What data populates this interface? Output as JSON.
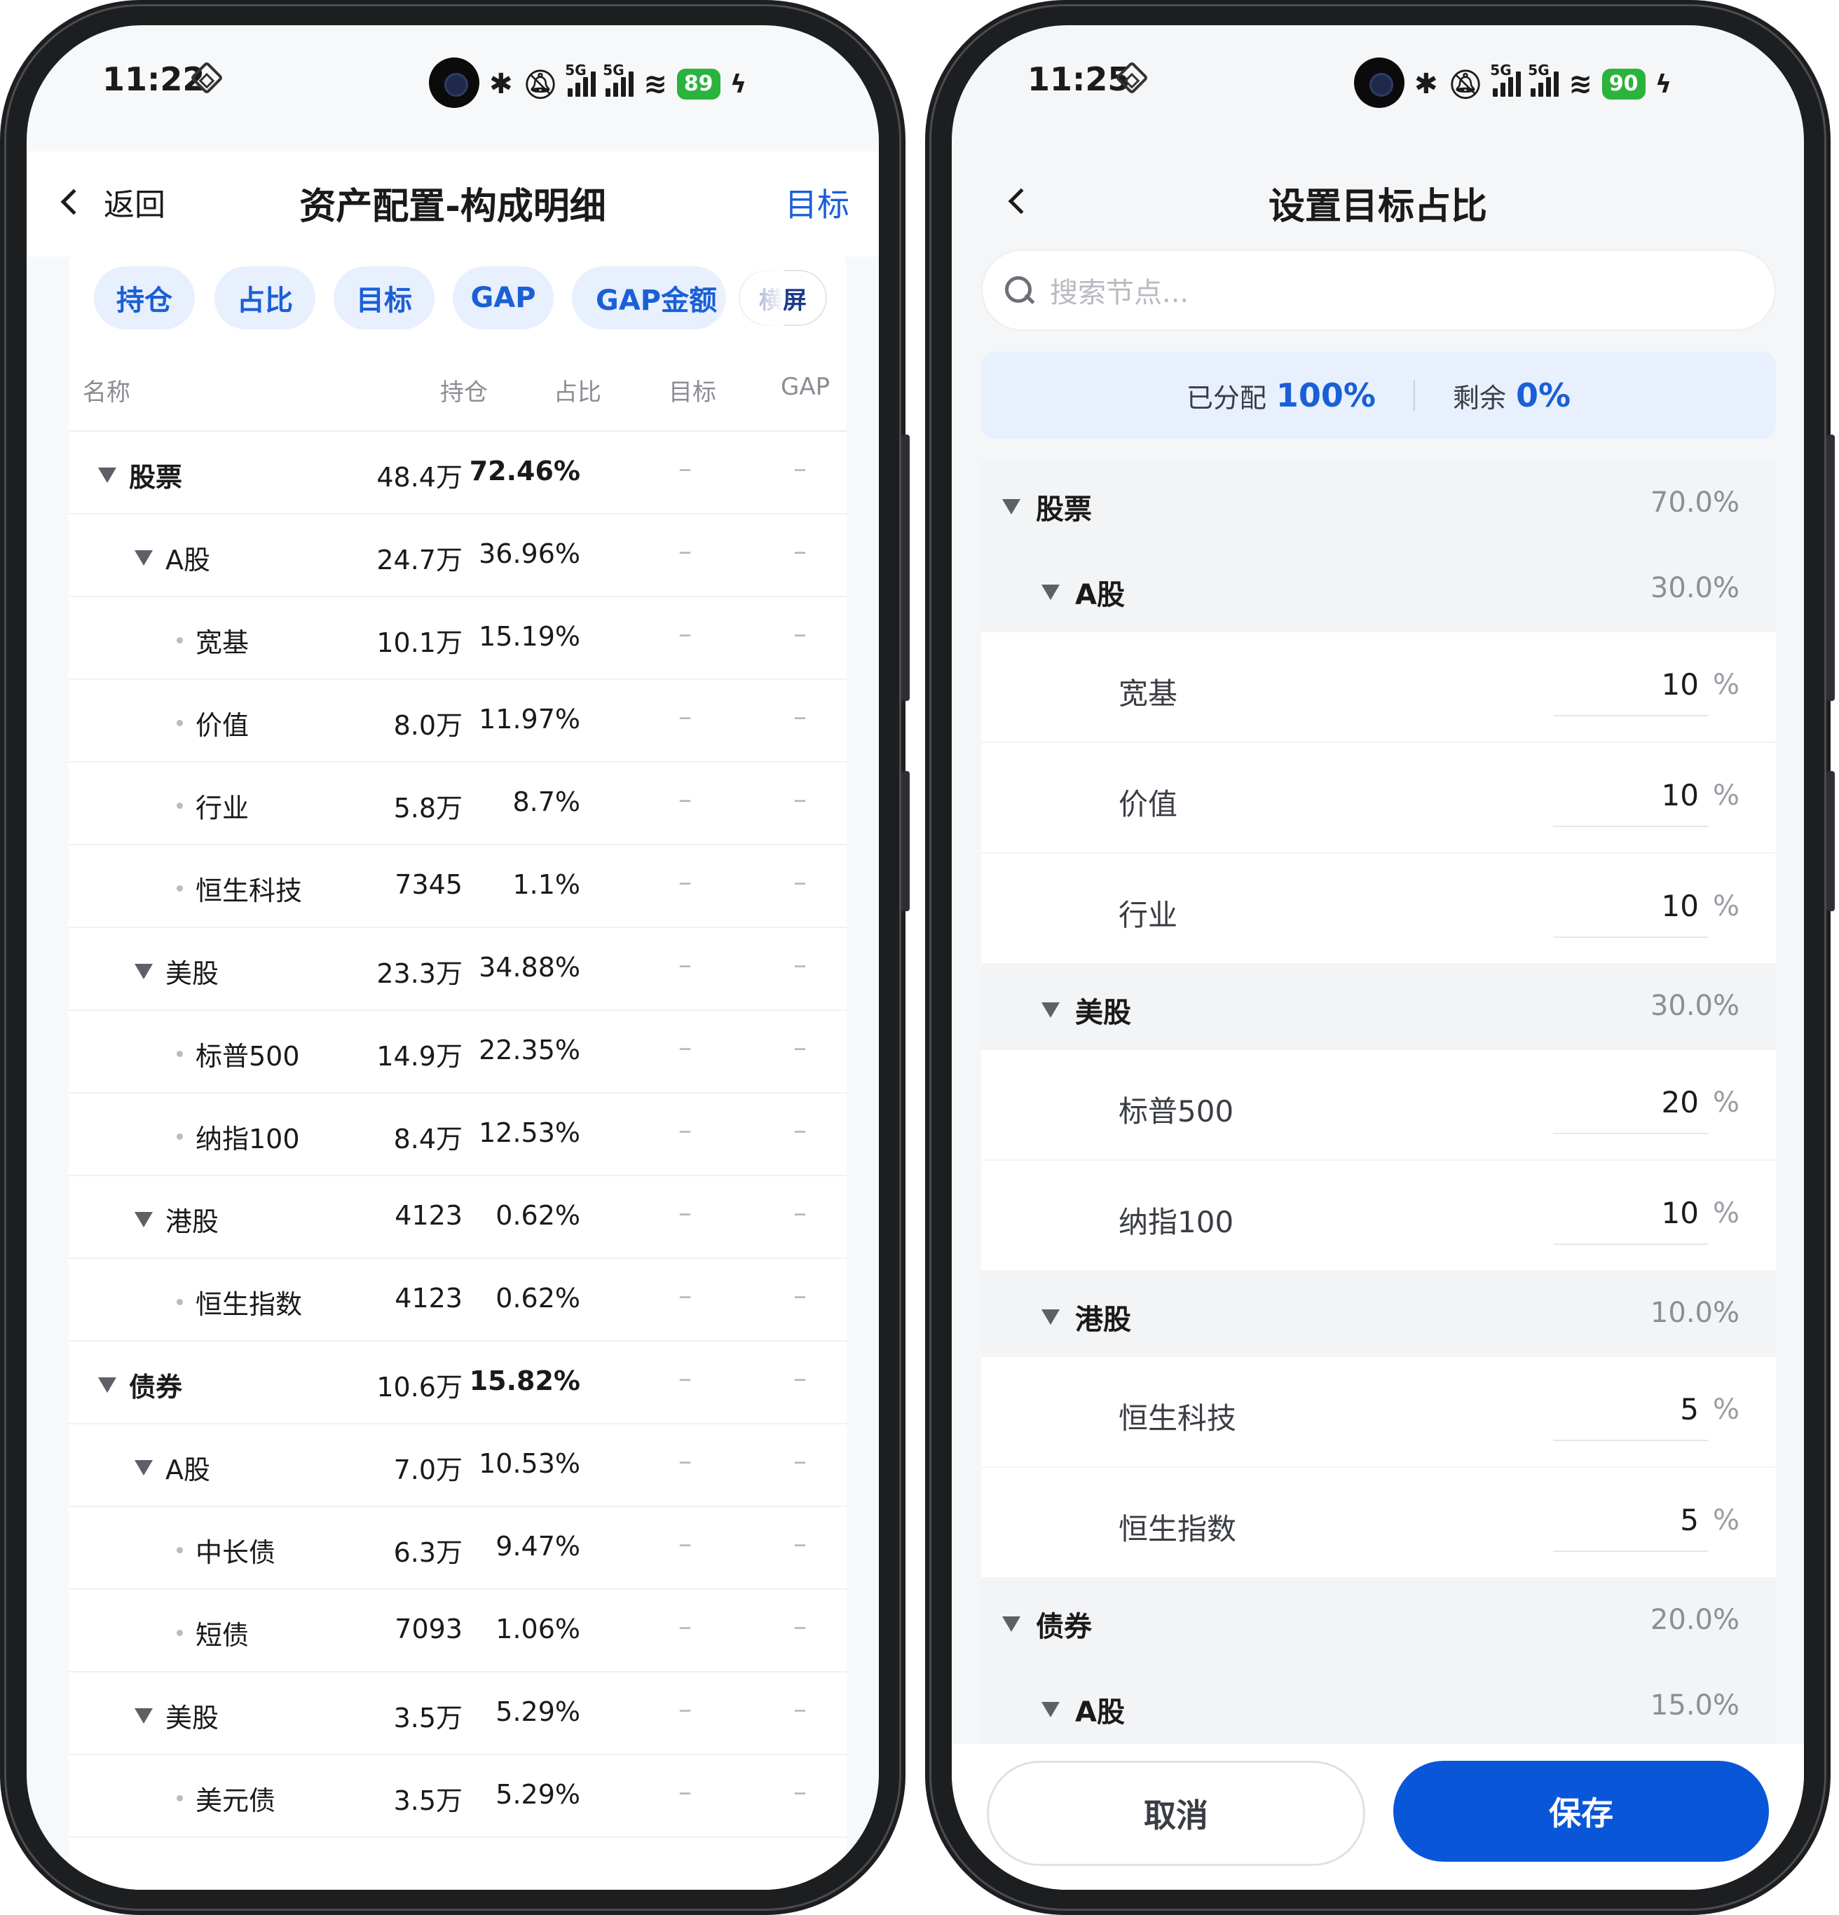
{
  "left": {
    "status": {
      "time": "11:22",
      "battery": "89"
    },
    "nav": {
      "back": "返回",
      "title": "资产配置-构成明细",
      "target": "目标"
    },
    "chips": [
      "持仓",
      "占比",
      "目标",
      "GAP",
      "GAP金额"
    ],
    "landscape": "横屏",
    "columns": {
      "name": "名称",
      "holding": "持仓",
      "ratio": "占比",
      "target": "目标",
      "gap": "GAP"
    },
    "dash": "–",
    "rows": [
      {
        "name": "股票",
        "holding": "48.4万",
        "ratio": "72.46%"
      },
      {
        "name": "A股",
        "holding": "24.7万",
        "ratio": "36.96%"
      },
      {
        "name": "宽基",
        "holding": "10.1万",
        "ratio": "15.19%"
      },
      {
        "name": "价值",
        "holding": "8.0万",
        "ratio": "11.97%"
      },
      {
        "name": "行业",
        "holding": "5.8万",
        "ratio": "8.7%"
      },
      {
        "name": "恒生科技",
        "holding": "7345",
        "ratio": "1.1%"
      },
      {
        "name": "美股",
        "holding": "23.3万",
        "ratio": "34.88%"
      },
      {
        "name": "标普500",
        "holding": "14.9万",
        "ratio": "22.35%"
      },
      {
        "name": "纳指100",
        "holding": "8.4万",
        "ratio": "12.53%"
      },
      {
        "name": "港股",
        "holding": "4123",
        "ratio": "0.62%"
      },
      {
        "name": "恒生指数",
        "holding": "4123",
        "ratio": "0.62%"
      },
      {
        "name": "债券",
        "holding": "10.6万",
        "ratio": "15.82%"
      },
      {
        "name": "A股",
        "holding": "7.0万",
        "ratio": "10.53%"
      },
      {
        "name": "中长债",
        "holding": "6.3万",
        "ratio": "9.47%"
      },
      {
        "name": "短债",
        "holding": "7093",
        "ratio": "1.06%"
      },
      {
        "name": "美股",
        "holding": "3.5万",
        "ratio": "5.29%"
      },
      {
        "name": "美元债",
        "holding": "3.5万",
        "ratio": "5.29%"
      }
    ]
  },
  "right": {
    "status": {
      "time": "11:25",
      "battery": "90"
    },
    "nav": {
      "title": "设置目标占比"
    },
    "search_placeholder": "搜索节点...",
    "allocated_label": "已分配",
    "allocated_value": "100%",
    "remaining_label": "剩余",
    "remaining_value": "0%",
    "unit": "%",
    "items": [
      {
        "name": "股票",
        "value": "70.0"
      },
      {
        "name": "A股",
        "value": "30.0"
      },
      {
        "name": "宽基",
        "value": "10"
      },
      {
        "name": "价值",
        "value": "10"
      },
      {
        "name": "行业",
        "value": "10"
      },
      {
        "name": "美股",
        "value": "30.0"
      },
      {
        "name": "标普500",
        "value": "20"
      },
      {
        "name": "纳指100",
        "value": "10"
      },
      {
        "name": "港股",
        "value": "10.0"
      },
      {
        "name": "恒生科技",
        "value": "5"
      },
      {
        "name": "恒生指数",
        "value": "5"
      },
      {
        "name": "债券",
        "value": "20.0"
      },
      {
        "name": "A股",
        "value": "15.0"
      }
    ],
    "cancel": "取消",
    "save": "保存"
  },
  "colors": {
    "accent": "#1a5fd6",
    "save_button": "#0a56d8",
    "battery": "#2ab33d",
    "alloc_bg": "#e7f0fc"
  }
}
